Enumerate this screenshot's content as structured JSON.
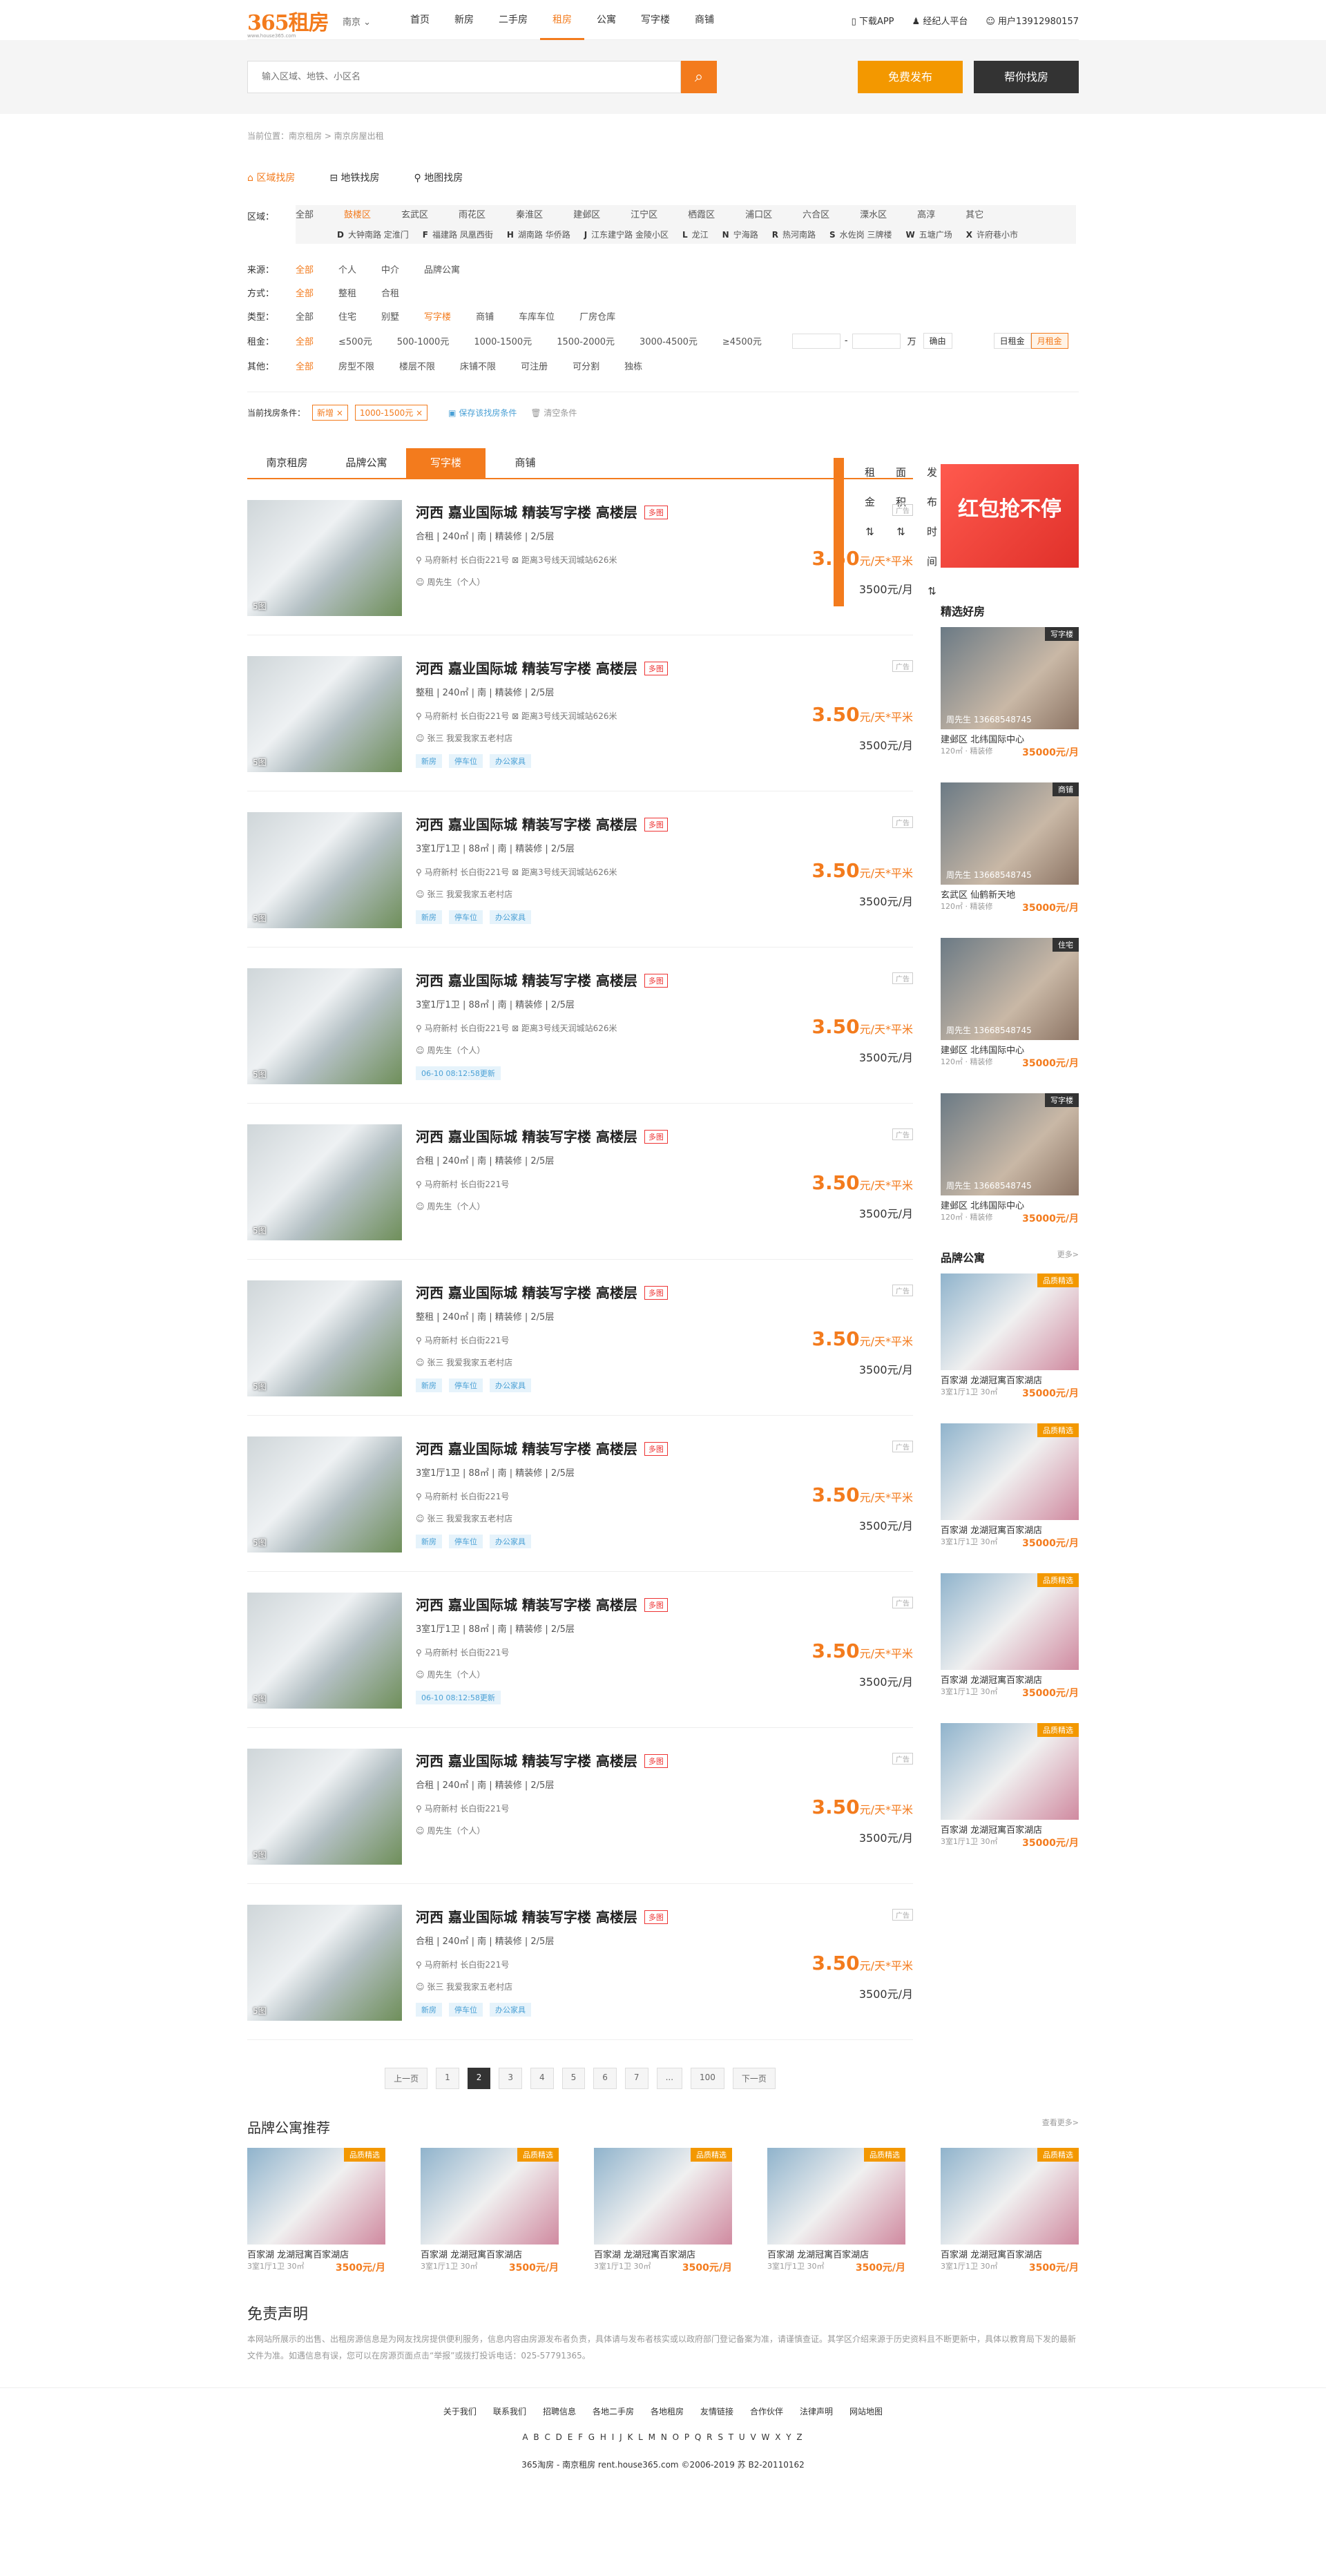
{
  "header": {
    "logo": "365租房",
    "logo_sub": "www.house365.com",
    "city": "南京",
    "nav": [
      "首页",
      "新房",
      "二手房",
      "租房",
      "公寓",
      "写字楼",
      "商铺"
    ],
    "nav_active": 3,
    "links": [
      "下载APP",
      "经纪人平台",
      "用户13912980157"
    ]
  },
  "search": {
    "placeholder": "输入区域、地铁、小区名",
    "publish": "免费发布",
    "help": "帮你找房"
  },
  "breadcrumb": "当前位置：南京租房 > 南京房屋出租",
  "search_modes": [
    "区域找房",
    "地铁找房",
    "地图找房"
  ],
  "filters": {
    "district_label": "区域：",
    "districts": [
      "全部",
      "鼓楼区",
      "玄武区",
      "雨花区",
      "秦淮区",
      "建邺区",
      "江宁区",
      "栖霞区",
      "浦口区",
      "六合区",
      "溧水区",
      "高淳",
      "其它"
    ],
    "subareas": [
      {
        "l": "D",
        "v": "大钟南路  定淮门"
      },
      {
        "l": "F",
        "v": "福建路  凤凰西街"
      },
      {
        "l": "H",
        "v": "湖南路  华侨路"
      },
      {
        "l": "J",
        "v": "江东建宁路  金陵小区"
      },
      {
        "l": "L",
        "v": "龙江"
      },
      {
        "l": "N",
        "v": "宁海路"
      },
      {
        "l": "R",
        "v": "热河南路"
      },
      {
        "l": "S",
        "v": "水佐岗  三牌楼"
      },
      {
        "l": "W",
        "v": "五塘广场"
      },
      {
        "l": "X",
        "v": "许府巷小市"
      }
    ],
    "source_label": "来源：",
    "sources": [
      "全部",
      "个人",
      "中介",
      "品牌公寓"
    ],
    "mode_label": "方式：",
    "modes": [
      "全部",
      "整租",
      "合租"
    ],
    "type_label": "类型：",
    "types": [
      "全部",
      "住宅",
      "别墅",
      "写字楼",
      "商铺",
      "车库车位",
      "厂房仓库"
    ],
    "rent_label": "租金：",
    "rents": [
      "全部",
      "≤500元",
      "500-1000元",
      "1000-1500元",
      "1500-2000元",
      "3000-4500元",
      "≥4500元"
    ],
    "unit": "万",
    "confirm": "确由",
    "day": "日租金",
    "month": "月租金",
    "other_label": "其他：",
    "others": [
      "全部",
      "房型不限",
      "楼层不限",
      "床铺不限",
      "可注册",
      "可分割",
      "独栋"
    ],
    "cond_label": "当前找房条件：",
    "conds": [
      "新增 ×",
      "1000-1500元 ×"
    ],
    "save": "保存该找房条件",
    "clear": "清空条件"
  },
  "list_tabs": [
    "南京租房",
    "品牌公寓",
    "写字楼",
    "商铺"
  ],
  "sorts": [
    "默认排序",
    "租金 ⇅",
    "面积 ⇅",
    "发布时间 ⇅"
  ],
  "items": [
    {
      "title": "河西 嘉业国际城 精装写字楼 高楼层",
      "info": "合租 | 240㎡ | 南 | 精装修 | 2/5层",
      "loc": "马府新村 长白街221号  ⊠ 距离3号线天润城站626米",
      "who": "周先生（个人）",
      "tags": [],
      "price": "3.50",
      "mp": "3500元/月",
      "cnt": "5图"
    },
    {
      "title": "河西 嘉业国际城 精装写字楼 高楼层",
      "info": "整租 | 240㎡ | 南 | 精装修 | 2/5层",
      "loc": "马府新村 长白街221号  ⊠ 距离3号线天润城站626米",
      "who": "张三  我爱我家五老村店",
      "tags": [
        "新房",
        "停车位",
        "办公家具"
      ],
      "price": "3.50",
      "mp": "3500元/月",
      "cnt": "5图"
    },
    {
      "title": "河西 嘉业国际城 精装写字楼 高楼层",
      "info": "3室1厅1卫 | 88㎡ | 南 | 精装修 | 2/5层",
      "loc": "马府新村 长白街221号  ⊠ 距离3号线天润城站626米",
      "who": "张三  我爱我家五老村店",
      "tags": [
        "新房",
        "停车位",
        "办公家具"
      ],
      "price": "3.50",
      "mp": "3500元/月",
      "cnt": "5图"
    },
    {
      "title": "河西 嘉业国际城 精装写字楼 高楼层",
      "info": "3室1厅1卫 | 88㎡ | 南 | 精装修 | 2/5层",
      "loc": "马府新村 长白街221号  ⊠ 距离3号线天润城站626米",
      "who": "周先生（个人）",
      "tags": [
        "06-10 08:12:58更新"
      ],
      "price": "3.50",
      "mp": "3500元/月",
      "cnt": "5图"
    },
    {
      "title": "河西 嘉业国际城 精装写字楼 高楼层",
      "info": "合租 | 240㎡ | 南 | 精装修 | 2/5层",
      "loc": "马府新村 长白街221号",
      "who": "周先生（个人）",
      "tags": [],
      "price": "3.50",
      "mp": "3500元/月",
      "cnt": "5图"
    },
    {
      "title": "河西 嘉业国际城 精装写字楼 高楼层",
      "info": "整租 | 240㎡ | 南 | 精装修 | 2/5层",
      "loc": "马府新村 长白街221号",
      "who": "张三  我爱我家五老村店",
      "tags": [
        "新房",
        "停车位",
        "办公家具"
      ],
      "price": "3.50",
      "mp": "3500元/月",
      "cnt": "5图"
    },
    {
      "title": "河西 嘉业国际城 精装写字楼 高楼层",
      "info": "3室1厅1卫 | 88㎡ | 南 | 精装修 | 2/5层",
      "loc": "马府新村 长白街221号",
      "who": "张三  我爱我家五老村店",
      "tags": [
        "新房",
        "停车位",
        "办公家具"
      ],
      "price": "3.50",
      "mp": "3500元/月",
      "cnt": "5图"
    },
    {
      "title": "河西 嘉业国际城 精装写字楼 高楼层",
      "info": "3室1厅1卫 | 88㎡ | 南 | 精装修 | 2/5层",
      "loc": "马府新村 长白街221号",
      "who": "周先生（个人）",
      "tags": [
        "06-10 08:12:58更新"
      ],
      "price": "3.50",
      "mp": "3500元/月",
      "cnt": "5图"
    },
    {
      "title": "河西 嘉业国际城 精装写字楼 高楼层",
      "info": "合租 | 240㎡ | 南 | 精装修 | 2/5层",
      "loc": "马府新村 长白街221号",
      "who": "周先生（个人）",
      "tags": [],
      "price": "3.50",
      "mp": "3500元/月",
      "cnt": "5图"
    },
    {
      "title": "河西 嘉业国际城 精装写字楼 高楼层",
      "info": "合租 | 240㎡ | 南 | 精装修 | 2/5层",
      "loc": "马府新村 长白街221号",
      "who": "张三  我爱我家五老村店",
      "tags": [
        "新房",
        "停车位",
        "办公家具"
      ],
      "price": "3.50",
      "mp": "3500元/月",
      "cnt": "5图"
    }
  ],
  "hot": "多图",
  "ad": "广告",
  "price_unit": "元/天*平米",
  "pager": [
    "上一页",
    "1",
    "2",
    "3",
    "4",
    "5",
    "6",
    "7",
    "...",
    "100",
    "下一页"
  ],
  "side": {
    "ad_text": "红包抢不停",
    "good_title": "精选好房",
    "good": [
      {
        "badge": "写字楼",
        "ph": "周先生 13668548745",
        "name": "建邺区 北纬国际中心",
        "spec": "120㎡ · 精装修",
        "price": "35000元/月"
      },
      {
        "badge": "商铺",
        "ph": "周先生 13668548745",
        "name": "玄武区 仙鹤新天地",
        "spec": "120㎡ · 精装修",
        "price": "35000元/月"
      },
      {
        "badge": "住宅",
        "ph": "周先生 13668548745",
        "name": "建邺区 北纬国际中心",
        "spec": "120㎡ · 精装修",
        "price": "35000元/月"
      },
      {
        "badge": "写字楼",
        "ph": "周先生 13668548745",
        "name": "建邺区 北纬国际中心",
        "spec": "120㎡ · 精装修",
        "price": "35000元/月"
      }
    ],
    "brand_title": "品牌公寓",
    "more": "更多>",
    "brand": [
      {
        "badge": "品质精选",
        "name": "百家湖 龙湖冠寓百家湖店",
        "spec": "3室1厅1卫 30㎡",
        "price": "35000元/月"
      },
      {
        "badge": "品质精选",
        "name": "百家湖 龙湖冠寓百家湖店",
        "spec": "3室1厅1卫 30㎡",
        "price": "35000元/月"
      },
      {
        "badge": "品质精选",
        "name": "百家湖 龙湖冠寓百家湖店",
        "spec": "3室1厅1卫 30㎡",
        "price": "35000元/月"
      },
      {
        "badge": "品质精选",
        "name": "百家湖 龙湖冠寓百家湖店",
        "spec": "3室1厅1卫 30㎡",
        "price": "35000元/月"
      }
    ]
  },
  "rec": {
    "title": "品牌公寓推荐",
    "more": "查看更多>",
    "items": [
      {
        "name": "百家湖 龙湖冠寓百家湖店",
        "spec": "3室1厅1卫 30㎡",
        "price": "3500元/月",
        "badge": "品质精选"
      },
      {
        "name": "百家湖 龙湖冠寓百家湖店",
        "spec": "3室1厅1卫 30㎡",
        "price": "3500元/月",
        "badge": "品质精选"
      },
      {
        "name": "百家湖 龙湖冠寓百家湖店",
        "spec": "3室1厅1卫 30㎡",
        "price": "3500元/月",
        "badge": "品质精选"
      },
      {
        "name": "百家湖 龙湖冠寓百家湖店",
        "spec": "3室1厅1卫 30㎡",
        "price": "3500元/月",
        "badge": "品质精选"
      },
      {
        "name": "百家湖 龙湖冠寓百家湖店",
        "spec": "3室1厅1卫 30㎡",
        "price": "3500元/月",
        "badge": "品质精选"
      }
    ]
  },
  "disclaimer": {
    "title": "免责声明",
    "text": "本网站所展示的出售、出租房源信息是为网友找房提供便利服务，信息内容由房源发布者负责，具体请与发布者核实或以政府部门登记备案为准，请谨慎查证。其学区介绍来源于历史资料且不断更新中，具体以教育局下发的最新文件为准。如遇信息有误，您可以在房源页面点击“举报”或拨打投诉电话：025-57791365。"
  },
  "footer": {
    "links": [
      "关于我们",
      "联系我们",
      "招聘信息",
      "各地二手房",
      "各地租房",
      "友情链接",
      "合作伙伴",
      "法律声明",
      "网站地图"
    ],
    "abc": "A B C D E F G H I J K L M N O P Q R S T U V W X Y Z",
    "copy": "365淘房 - 南京租房 rent.house365.com ©2006-2019  苏 B2-20110162"
  }
}
